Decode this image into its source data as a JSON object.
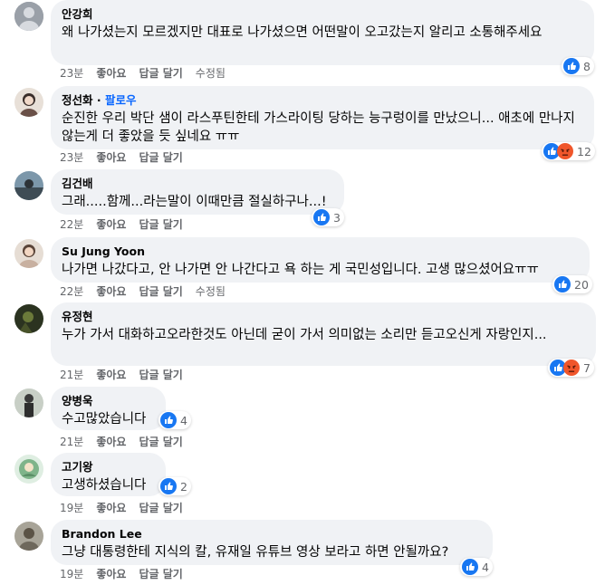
{
  "comments": [
    {
      "author": "안강희",
      "badge": "",
      "text": "왜 나가셨는지 모르겠지만 대표로 나가셨으면 어떤말이 오고갔는지 알리고 소통해주세요",
      "time": "23분",
      "like": "좋아요",
      "reply": "답글 달기",
      "edited": "수정됨",
      "reactions": [
        "like"
      ],
      "count": "8",
      "avatar_color": "#8a8f98"
    },
    {
      "author": "정선화",
      "badge": "팔로우",
      "text": "순진한 우리 박단 샘이 라스푸틴한테 가스라이팅 당하는 능구렁이를 만났으니... 애초에 만나지 않는게 더 좋았을 듯 싶네요 ㅠㅠ",
      "time": "23분",
      "like": "좋아요",
      "reply": "답글 달기",
      "edited": "",
      "reactions": [
        "like",
        "angry"
      ],
      "count": "12",
      "avatar_color": "#c9b8a8"
    },
    {
      "author": "김건배",
      "badge": "",
      "text": "그래.....함께...라는말이 이때만큼 절실하구나...!",
      "time": "22분",
      "like": "좋아요",
      "reply": "답글 달기",
      "edited": "",
      "reactions": [
        "like"
      ],
      "count": "3",
      "avatar_color": "#4d6a7e"
    },
    {
      "author": "Su Jung Yoon",
      "badge": "",
      "text": "나가면 나갔다고, 안 나가면 안 나간다고 욕 하는 게 국민성입니다. 고생 많으셨어요ㅠㅠ",
      "time": "22분",
      "like": "좋아요",
      "reply": "답글 달기",
      "edited": "수정됨",
      "reactions": [
        "like"
      ],
      "count": "20",
      "avatar_color": "#b49a88"
    },
    {
      "author": "유정현",
      "badge": "",
      "text": "누가 가서 대화하고오라한것도 아닌데 굳이 가서 의미없는 소리만 듣고오신게 자랑인지...",
      "time": "21분",
      "like": "좋아요",
      "reply": "답글 달기",
      "edited": "",
      "reactions": [
        "like",
        "angry"
      ],
      "count": "7",
      "avatar_color": "#3f4a2e"
    },
    {
      "author": "양병욱",
      "badge": "",
      "text": "수고많았습니다",
      "time": "21분",
      "like": "좋아요",
      "reply": "답글 달기",
      "edited": "",
      "reactions": [
        "like"
      ],
      "count": "4",
      "avatar_color": "#9aa39a"
    },
    {
      "author": "고기왕",
      "badge": "",
      "text": "고생하셨습니다",
      "time": "19분",
      "like": "좋아요",
      "reply": "답글 달기",
      "edited": "",
      "reactions": [
        "like"
      ],
      "count": "2",
      "avatar_color": "#7fb48a"
    },
    {
      "author": "Brandon Lee",
      "badge": "",
      "text": "그냥 대통령한테 지식의 칼, 유재일 유튜브 영상 보라고 하면 안될까요?",
      "time": "19분",
      "like": "좋아요",
      "reply": "답글 달기",
      "edited": "",
      "reactions": [
        "like"
      ],
      "count": "4",
      "avatar_color": "#8d8a80"
    }
  ],
  "colors": {
    "like": "#1877f2",
    "angry": "#f0562b",
    "bubble": "#f0f2f5",
    "meta": "#65676b",
    "follow": "#0866ff"
  }
}
